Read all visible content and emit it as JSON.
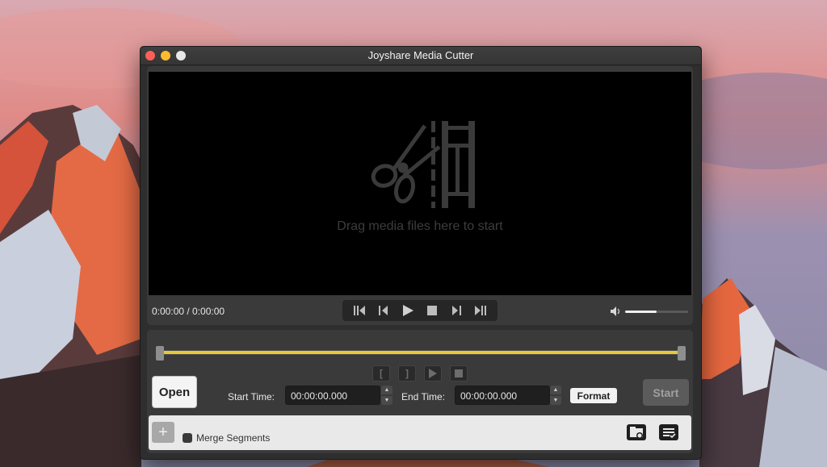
{
  "window": {
    "title": "Joyshare Media Cutter"
  },
  "player": {
    "drop_text": "Drag media files here to start",
    "time_readout": "0:00:00 / 0:00:00",
    "volume_level": 0.5
  },
  "editor": {
    "open_label": "Open",
    "start_time_label": "Start Time:",
    "start_time_value": "00:00:00.000",
    "end_time_label": "End Time:",
    "end_time_value": "00:00:00.000",
    "format_label": "Format",
    "start_label": "Start",
    "merge_label": "Merge Segments",
    "add_symbol": "+"
  },
  "colors": {
    "timeline_selection": "#e6c83a",
    "close": "#fc5f57",
    "minimize": "#fdbc2e"
  }
}
